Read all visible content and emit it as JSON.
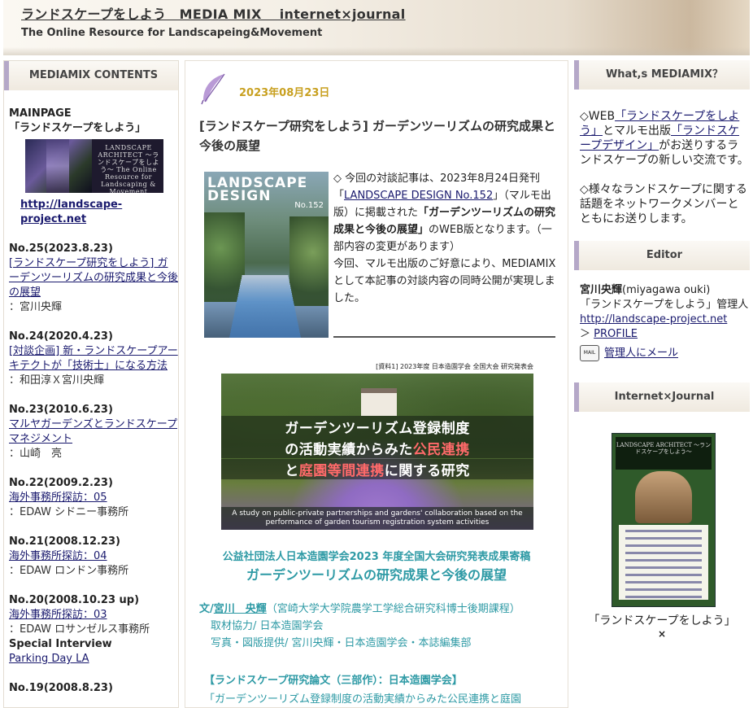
{
  "header": {
    "title": "ランドスケープをしよう　MEDIA MIX　 internet×journal",
    "subtitle": "The Online Resource for Landscapeing&Movement"
  },
  "left": {
    "heading": "MEDIAMIX CONTENTS",
    "mainpage_label": "MAINPAGE",
    "mainpage_title": "「ランドスケープをしよう」",
    "banner_text": "LANDSCAPE ARCHITECT ～ランドスケープをしよう～ The Online Resource for Landscaping & Movement",
    "site_url": "http://landscape-project.net",
    "items": [
      {
        "num": "No.25(2023.8.23)",
        "link": "[ランドスケープ研究をしよう] ガーデンツーリズムの研究成果と今後の展望",
        "author": "：宮川央輝"
      },
      {
        "num": "No.24(2020.4.23)",
        "link": "[対談企画] 新・ランドスケープアーキテクトが「技術士」になる方法",
        "author": "：和田淳Ｘ宮川央輝"
      },
      {
        "num": "No.23(2010.6.23)",
        "link": "マルヤガーデンズとランドスケープマネジメント",
        "author": "：山崎　亮"
      },
      {
        "num": "No.22(2009.2.23)",
        "link": "海外事務所探訪：05",
        "author": "：EDAW シドニー事務所"
      },
      {
        "num": "No.21(2008.12.23)",
        "link": "海外事務所探訪：04",
        "author": "：EDAW ロンドン事務所"
      },
      {
        "num": "No.20(2008.10.23 up)",
        "link": "海外事務所探訪：03",
        "author": "：EDAW ロサンゼルス事務所"
      }
    ],
    "special_label": "Special Interview",
    "special_link": "Parking Day LA",
    "next_num": "No.19(2008.8.23)"
  },
  "post": {
    "date": "2023年08月23日",
    "title": "[ランドスケープ研究をしよう] ガーデンツーリズムの研究成果と今後の展望",
    "magazine_title": "LANDSCAPE DESIGN",
    "magazine_no": "No.152",
    "intro_a": "◇ 今回の対談記事は、2023年8月24日発刊「",
    "intro_link": "LANDSCAPE DESIGN No.152",
    "intro_b": "」（マルモ出版）に掲載された",
    "intro_bold": "「ガーデンツーリズムの研究成果と今後の展望」",
    "intro_c": "のWEB版となります。（一部内容の変更があります）",
    "intro_d": "今回、マルモ出版のご好意により、MEDIAMIXとして本記事の対談内容の同時公開が実現しました。",
    "poster_caption": "[資料1] 2023年度 日本造園学会 全国大会 研究発表会",
    "poster_line1a": "ガーデンツーリズム登録制度",
    "poster_line1b": "の活動実績からみた",
    "poster_line1c": "公民連携",
    "poster_line2a": "と",
    "poster_line2b": "庭園等間連携",
    "poster_line2c": "に関する研究",
    "poster_en": "A study on public-private partnerships and gardens' collaboration based on the performance of garden tourism registration system activities",
    "sub1": "公益社団法人日本造園学会2023 年度全国大会研究発表成果寄稿",
    "sub2": "ガーデンツーリズムの研究成果と今後の展望",
    "credit_label": "文/",
    "credit_name": "宮川　央輝",
    "credit_aff": "（宮崎大学大学院農学工学総合研究科博士後期課程）",
    "credit2": "取材協力/ 日本造園学会",
    "credit3": "写真・図版提供/ 宮川央輝・日本造園学会・本誌編集部",
    "ronbun_head": "【ランドスケープ研究論文（三部作）：日本造園学会】",
    "ronbun_line": "「ガーデンツーリズム登録制度の活動実績からみた公民連携と庭園"
  },
  "right": {
    "heading1": "What,s MEDIAMIX？",
    "p1a": "◇WEB",
    "p1link1": "「ランドスケープをしよう」",
    "p1b": "とマルモ出版",
    "p1link2": "「ランドスケープデザイン」",
    "p1c": "がお送りするランドスケープの新しい交流です。",
    "p2": "◇様々なランドスケープに関する話題をネットワークメンバーとともにお送りします。",
    "heading2": "Editor",
    "editor_name": "宮川央輝",
    "editor_roman": "(miyagawa ouki)",
    "editor_role": "「ランドスケープをしよう」管理人",
    "editor_url": "http://landscape-project.net",
    "profile_prefix": "＞ ",
    "profile_link": "PROFILE",
    "mail_icon": "MAIL",
    "mail_link": "管理人にメール",
    "heading3": "Internet×Journal",
    "ij_banner_text": "LANDSCAPE ARCHITECT ～ランドスケープをしよう～",
    "ij_caption": "「ランドスケープをしよう」",
    "ij_x": "×"
  }
}
